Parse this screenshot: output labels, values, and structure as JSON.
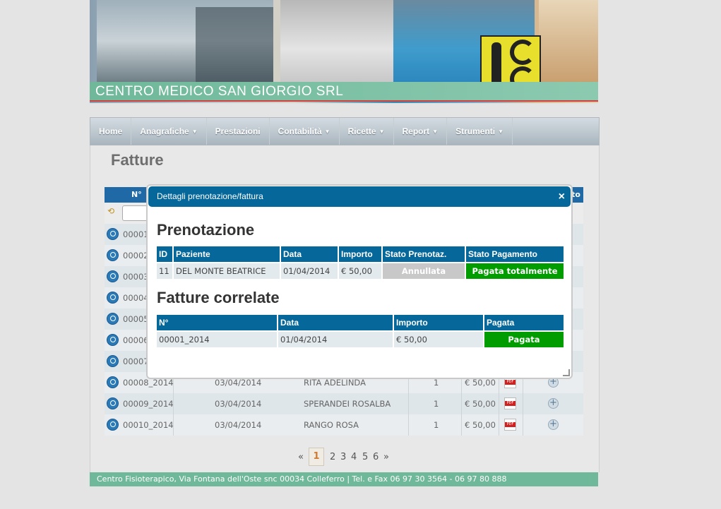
{
  "banner": {
    "title": "CENTRO MEDICO SAN GIORGIO SRL"
  },
  "nav": {
    "items": [
      {
        "label": "Home",
        "dropdown": false
      },
      {
        "label": "Anagrafiche",
        "dropdown": true
      },
      {
        "label": "Prestazioni",
        "dropdown": false
      },
      {
        "label": "Contabilità",
        "dropdown": true
      },
      {
        "label": "Ricette",
        "dropdown": true
      },
      {
        "label": "Report",
        "dropdown": true
      },
      {
        "label": "Strumenti",
        "dropdown": true
      }
    ]
  },
  "page": {
    "title": "Fatture"
  },
  "grid": {
    "header_no": "N°",
    "header_last_partial": "to",
    "rows": [
      {
        "no": "00001_",
        "date": "",
        "paziente": "",
        "qty": "",
        "importo": ""
      },
      {
        "no": "00002_",
        "date": "",
        "paziente": "",
        "qty": "",
        "importo": ""
      },
      {
        "no": "00003_",
        "date": "",
        "paziente": "",
        "qty": "",
        "importo": ""
      },
      {
        "no": "00004_",
        "date": "",
        "paziente": "",
        "qty": "",
        "importo": ""
      },
      {
        "no": "00005_",
        "date": "",
        "paziente": "",
        "qty": "",
        "importo": ""
      },
      {
        "no": "00006_",
        "date": "",
        "paziente": "",
        "qty": "",
        "importo": ""
      },
      {
        "no": "00007_",
        "date": "",
        "paziente": "",
        "qty": "",
        "importo": ""
      },
      {
        "no": "00008_2014",
        "date": "03/04/2014",
        "paziente": "RITA ADELINDA",
        "qty": "1",
        "importo": "€ 50,00"
      },
      {
        "no": "00009_2014",
        "date": "03/04/2014",
        "paziente": "SPERANDEI ROSALBA",
        "qty": "1",
        "importo": "€ 50,00"
      },
      {
        "no": "00010_2014",
        "date": "03/04/2014",
        "paziente": "RANGO ROSA",
        "qty": "1",
        "importo": "€ 50,00"
      }
    ]
  },
  "pager": {
    "prev": "«",
    "current": "1",
    "pages": [
      "2",
      "3",
      "4",
      "5",
      "6"
    ],
    "next": "»"
  },
  "footer": {
    "text": "Centro Fisioterapico, Via Fontana dell'Oste snc 00034 Colleferro | Tel. e Fax 06 97 30 3564 - 06 97 80 888"
  },
  "modal": {
    "title": "Dettagli prenotazione/fattura",
    "close": "×",
    "booking": {
      "heading": "Prenotazione",
      "headers": [
        "ID",
        "Paziente",
        "Data",
        "Importo",
        "Stato Prenotaz.",
        "Stato Pagamento"
      ],
      "row": {
        "id": "11",
        "paziente": "DEL MONTE BEATRICE",
        "data": "01/04/2014",
        "importo": "€ 50,00",
        "stato_prenotazione": "Annullata",
        "stato_pagamento": "Pagata totalmente"
      }
    },
    "invoices": {
      "heading": "Fatture correlate",
      "headers": [
        "N°",
        "Data",
        "Importo",
        "Pagata"
      ],
      "row": {
        "no": "00001_2014",
        "data": "01/04/2014",
        "importo": "€ 50,00",
        "pagata": "Pagata"
      }
    }
  },
  "colors": {
    "primary": "#05679a",
    "green": "#009c00",
    "footer": "#6fb89a"
  }
}
